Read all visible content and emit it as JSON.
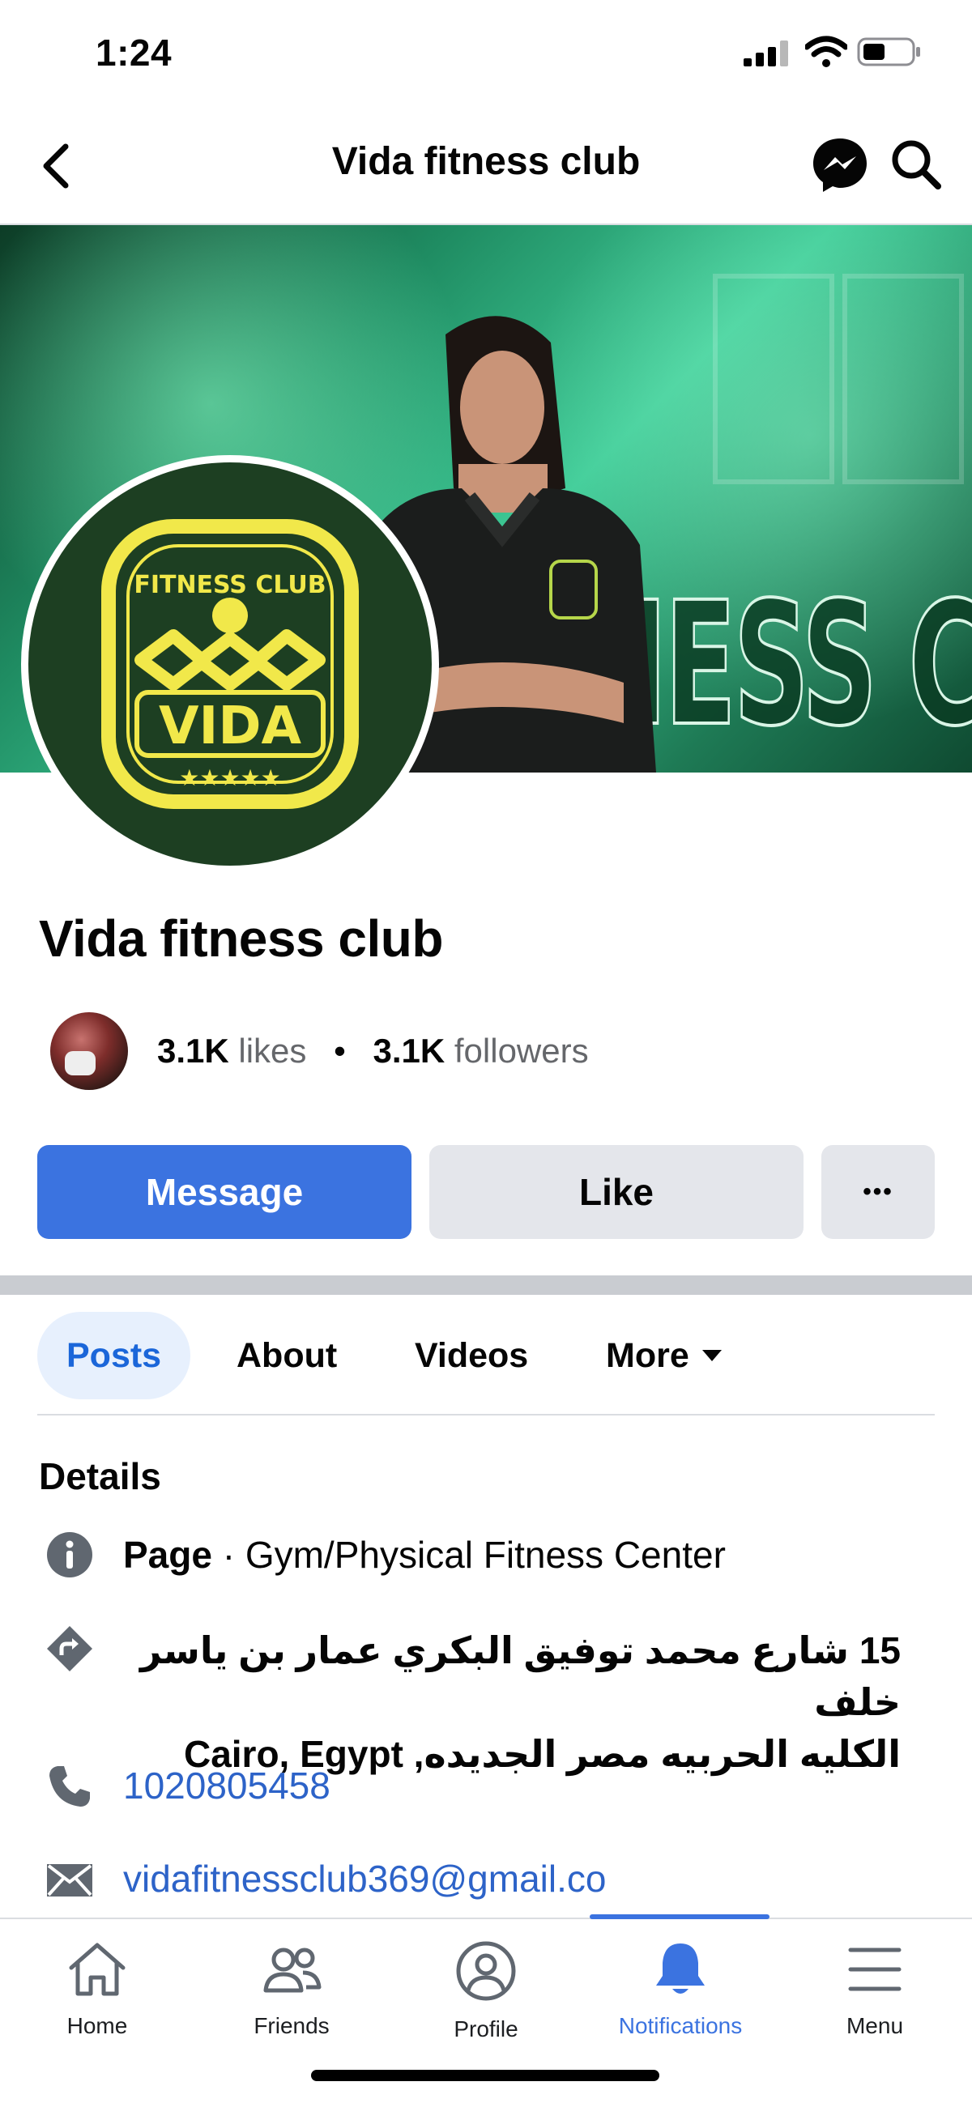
{
  "status_bar": {
    "time": "1:24"
  },
  "header": {
    "title": "Vida fitness club"
  },
  "cover": {
    "banner_text": "FITNESS CLUB"
  },
  "profile": {
    "logo": {
      "top": "FITNESS CLUB",
      "name": "VIDA",
      "stars": "★★★★★"
    },
    "name": "Vida fitness club",
    "likes_count": "3.1K",
    "likes_label": "likes",
    "followers_count": "3.1K",
    "followers_label": "followers"
  },
  "actions": {
    "message": "Message",
    "like": "Like",
    "more": "•••"
  },
  "tabs": [
    {
      "label": "Posts",
      "active": true
    },
    {
      "label": "About"
    },
    {
      "label": "Videos"
    },
    {
      "label": "More"
    }
  ],
  "details": {
    "title": "Details",
    "page_label": "Page",
    "page_category": "· Gym/Physical Fitness Center",
    "address_line1": "15 شارع محمد توفيق البكري عمار بن ياسر خلف",
    "address_line2": "الكليه الحربيه مصر الجديده, Cairo, Egypt",
    "phone": "1020805458",
    "email": "vidafitnessclub369@gmail.co"
  },
  "bottom_nav": [
    {
      "label": "Home",
      "icon": "home-icon"
    },
    {
      "label": "Friends",
      "icon": "friends-icon"
    },
    {
      "label": "Profile",
      "icon": "profile-icon"
    },
    {
      "label": "Notifications",
      "icon": "bell-icon",
      "active": true
    },
    {
      "label": "Menu",
      "icon": "menu-icon"
    }
  ],
  "colors": {
    "accent": "#3b73e0",
    "link": "#2d63c8",
    "logo_bg": "#1d3f22",
    "logo_yellow": "#f1e84a"
  }
}
